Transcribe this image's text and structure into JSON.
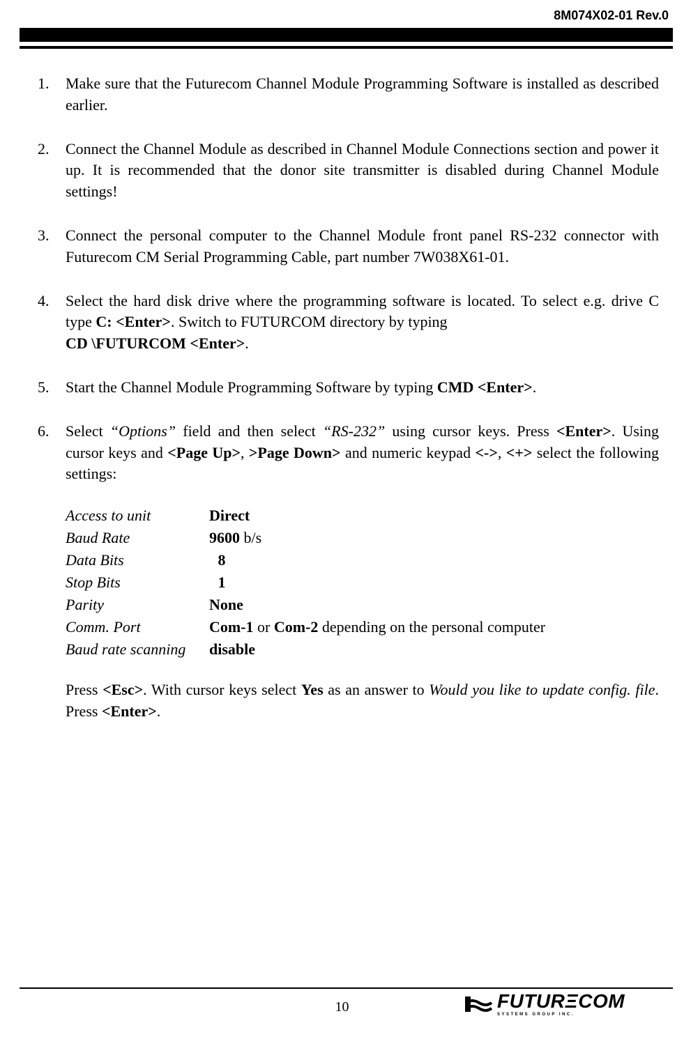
{
  "header": {
    "doc_id": "8M074X02-01 Rev.0"
  },
  "list": {
    "items": [
      {
        "num": "1.",
        "html": "Make sure that the Futurecom Channel Module Programming Software is installed as described earlier."
      },
      {
        "num": "2.",
        "html": "Connect the Channel Module as described in Channel Module Connections section and power it up.  It is recommended that the donor site transmitter is disabled during Channel Module settings!"
      },
      {
        "num": "3.",
        "html": "Connect the personal computer to the Channel Module front panel RS-232 connector with Futurecom CM Serial Programming Cable, part number 7W038X61-01."
      },
      {
        "num": "4.",
        "html": "Select the hard disk drive where the programming software is located.  To select e.g. drive C type <span class=\"bold\">C: &lt;Enter&gt;</span>.  Switch to FUTURCOM directory by typing<br><span class=\"bold\">CD \\FUTURCOM &lt;Enter&gt;</span>."
      },
      {
        "num": "5.",
        "html": "Start the Channel Module Programming Software by typing <span class=\"bold\">CMD &lt;Enter&gt;</span>."
      },
      {
        "num": "6.",
        "html_intro": "Select <span class=\"ital\">&ldquo;Options&rdquo;</span> field and then select <span class=\"ital\">&ldquo;RS-232&rdquo;</span> using cursor keys.  Press <span class=\"bold\">&lt;Enter&gt;</span>.  Using cursor keys and  <span class=\"bold\">&lt;Page Up&gt;</span>,  <span class=\"bold\">&gt;Page Down&gt;</span> and numeric keypad  <span class=\"bold\">&lt;-&gt;</span>,  <span class=\"bold\">&lt;+&gt;</span>  select the following settings:",
        "settings": [
          {
            "label": "Access to unit",
            "val_html": "<span class=\"bold\">Direct</span>",
            "cls": ""
          },
          {
            "label": "Baud Rate",
            "val_html": "<span class=\"bold\">9600</span> b/s",
            "cls": ""
          },
          {
            "label": "Data Bits",
            "val_html": "<span class=\"bold\">8</span>",
            "cls": "v8"
          },
          {
            "label": "Stop Bits",
            "val_html": "<span class=\"bold\">1</span>",
            "cls": "v1"
          },
          {
            "label": "Parity",
            "val_html": "<span class=\"bold\">None</span>",
            "cls": ""
          },
          {
            "label": "Comm. Port",
            "val_html": "<span class=\"bold\">Com-1</span> or <span class=\"bold\">Com-2</span> depending on the personal computer",
            "cls": ""
          },
          {
            "label": "Baud rate scanning",
            "val_html": "<span class=\"bold\">disable</span>",
            "cls": ""
          }
        ],
        "html_outro": "Press <span class=\"bold\">&lt;Esc&gt;</span>.  With cursor keys select  <span class=\"bold\">Yes</span> as an answer to  <span class=\"ital\">Would you like to update config. file</span>.  Press <span class=\"bold\">&lt;Enter&gt;</span>."
      }
    ]
  },
  "footer": {
    "page_num": "10",
    "logo_main": "FUTURΞCOM",
    "logo_sub": "SYSTEMS GROUP INC."
  }
}
